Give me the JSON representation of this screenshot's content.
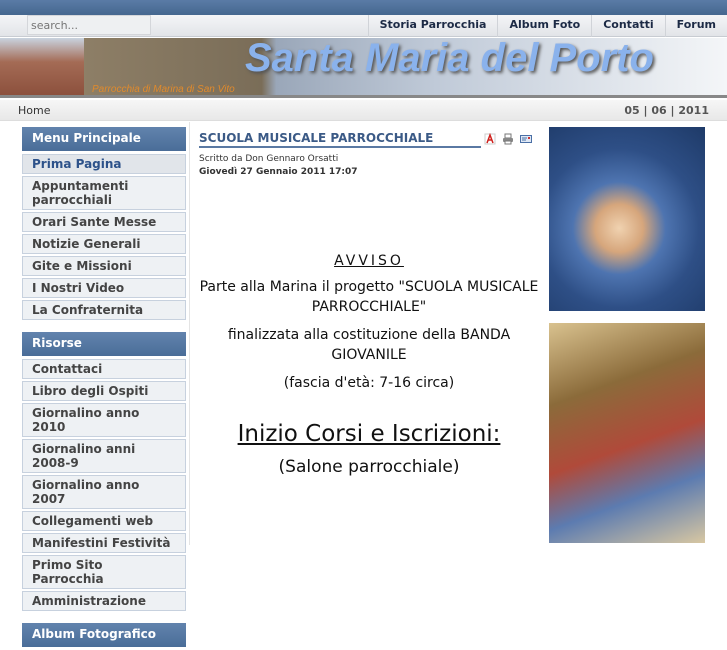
{
  "search": {
    "placeholder": "search..."
  },
  "top_menu": [
    "Storia Parrocchia",
    "Album Foto",
    "Contatti",
    "Forum"
  ],
  "banner": {
    "title": "Santa Maria del Porto",
    "subtitle": "Parrocchia di Marina di San Vito"
  },
  "breadcrumb": "Home",
  "date": "05 | 06 | 2011",
  "menu_principale": {
    "title": "Menu Principale",
    "items": [
      "Prima Pagina",
      "Appuntamenti parrocchiali",
      "Orari Sante Messe",
      "Notizie Generali",
      "Gite e Missioni",
      "I Nostri Video",
      "La Confraternita"
    ]
  },
  "risorse": {
    "title": "Risorse",
    "items": [
      "Contattaci",
      "Libro degli Ospiti",
      "Giornalino anno 2010",
      "Giornalino anni 2008-9",
      "Giornalino anno 2007",
      "Collegamenti web",
      "Manifestini Festività",
      "Primo Sito Parrocchia",
      "Amministrazione"
    ]
  },
  "album": {
    "title": "Album Fotografico"
  },
  "article": {
    "title": "SCUOLA MUSICALE PARROCCHIALE",
    "author": "Scritto da Don Gennaro Orsatti",
    "date": "Giovedì 27 Gennaio 2011 17:07",
    "avviso": "AVVISO",
    "p1": "Parte alla Marina il progetto \"SCUOLA MUSICALE PARROCCHIALE\"",
    "p2": "finalizzata alla costituzione della BANDA GIOVANILE",
    "p3": "(fascia d'età: 7-16 circa)",
    "heading": "Inizio Corsi e Iscrizioni:",
    "p4": "(Salone parrocchiale)"
  }
}
